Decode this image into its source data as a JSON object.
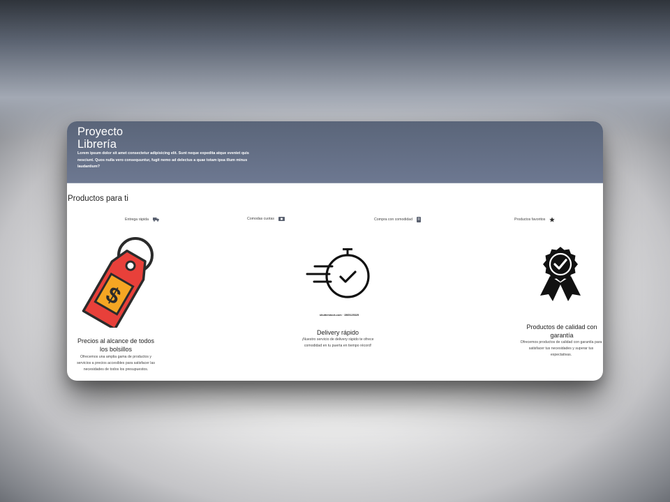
{
  "hero": {
    "title": "Proyecto Librería",
    "description": "Lorem ipsum dolor sit amet consectetur adipisicing elit. Sunt neque expedita atque eveniet quis nesciunt. Quos nulla vero consequuntur, fugit nemo ad delectus a quae totam ipsa illum minus laudantium?"
  },
  "section": {
    "title": "Productos para ti"
  },
  "features": [
    {
      "label": "Entrega rápida",
      "icon": "truck-icon"
    },
    {
      "label": "Comodas cuotas",
      "icon": "money-icon"
    },
    {
      "label": "Compra con comodidad",
      "icon": "mobile-icon"
    },
    {
      "label": "Productos favoritos",
      "icon": "star-icon"
    }
  ],
  "products": [
    {
      "title": "Precios al alcance de todos los bolsillos",
      "description": "Ofrecemos una amplia gama de productos y servicios a precios accesibles para satisfacer las necesidades de todos los presupuestos.",
      "icon": "price-tag-icon"
    },
    {
      "title": "Delivery rápido",
      "description": "¡Nuestro servicio de delivery rápido te ofrece comodidad en tu puerta en tiempo récord!",
      "icon": "stopwatch-icon",
      "image_credit": "shutterstock.com · 1565125325"
    },
    {
      "title": "Productos de calidad con garantía",
      "description": "Ofrecemos productos de calidad con garantía para satisfacer tus necesidades y superar tus expectativas.",
      "icon": "award-ribbon-icon"
    }
  ],
  "colors": {
    "hero_background": "#6b7690",
    "tag_red": "#e8403a",
    "tag_orange": "#f5a623",
    "text_dark": "#222222"
  }
}
